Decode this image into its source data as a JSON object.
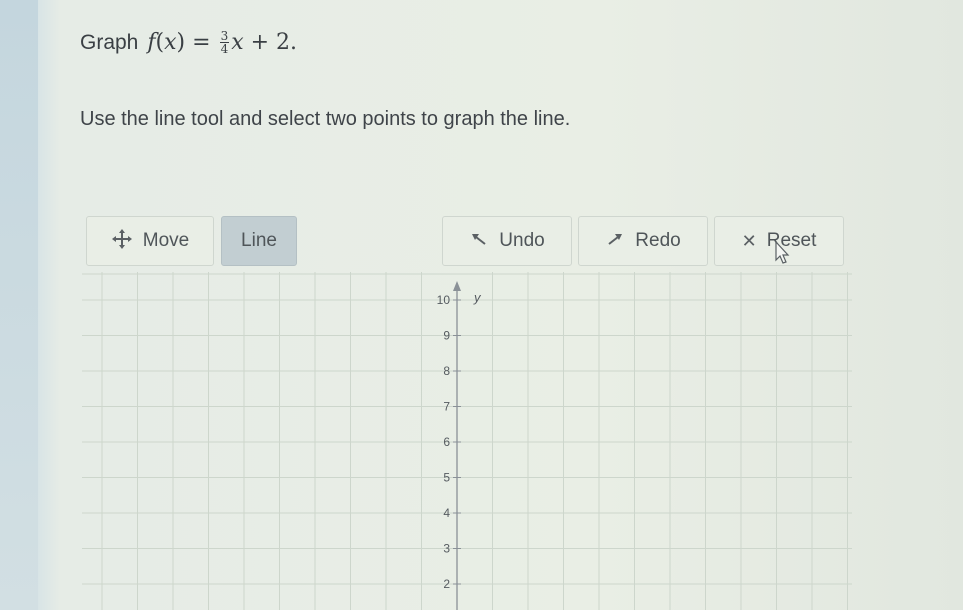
{
  "prompt": {
    "label": "Graph",
    "fn": "f",
    "var": "x",
    "num": "3",
    "den": "4",
    "const": "2",
    "tail": "."
  },
  "instruction": "Use the line tool and select two points to graph the line.",
  "toolbar": {
    "move": {
      "label": "Move",
      "icon": "move-icon"
    },
    "line": {
      "label": "Line",
      "active": true
    },
    "undo": {
      "label": "Undo",
      "icon": "undo-arrow-icon"
    },
    "redo": {
      "label": "Redo",
      "icon": "redo-arrow-icon"
    },
    "reset": {
      "label": "Reset",
      "icon": "close-x-icon"
    }
  },
  "graph": {
    "y_axis_label": "y",
    "y_ticks": [
      10,
      9,
      8,
      7,
      6,
      5,
      4,
      3,
      2
    ]
  }
}
